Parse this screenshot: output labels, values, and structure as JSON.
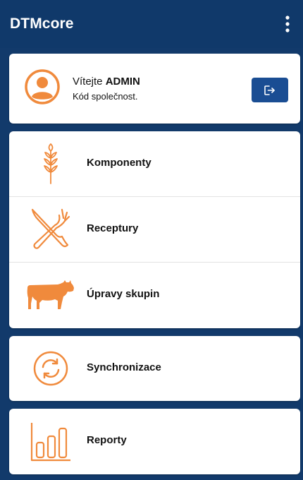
{
  "app": {
    "title": "DTMcore"
  },
  "user": {
    "welcome_prefix": "Vítejte",
    "username": "ADMIN",
    "company_label": "Kód společnost."
  },
  "menu": {
    "components": "Komponenty",
    "recipes": "Receptury",
    "group_edits": "Úpravy skupin",
    "sync": "Synchronizace",
    "reports": "Reporty"
  },
  "colors": {
    "primary": "#10396a",
    "accent": "#f08a3c",
    "button": "#1a4d93"
  },
  "icons": {
    "menu": "more-vert-icon",
    "avatar": "user-avatar-icon",
    "logout": "logout-icon",
    "components": "wheat-icon",
    "recipes": "utensils-icon",
    "group_edits": "cow-icon",
    "sync": "sync-icon",
    "reports": "bar-chart-icon"
  }
}
